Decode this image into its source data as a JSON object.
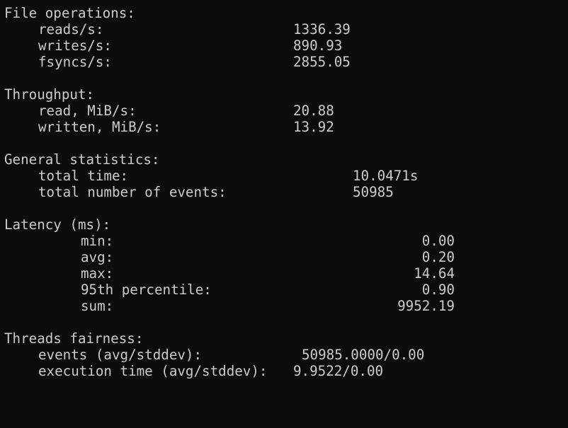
{
  "file_operations": {
    "title": "File operations:",
    "rows": [
      {
        "label": "reads/s:",
        "value": "1336.39"
      },
      {
        "label": "writes/s:",
        "value": "890.93"
      },
      {
        "label": "fsyncs/s:",
        "value": "2855.05"
      }
    ]
  },
  "throughput": {
    "title": "Throughput:",
    "rows": [
      {
        "label": "read, MiB/s:",
        "value": "20.88"
      },
      {
        "label": "written, MiB/s:",
        "value": "13.92"
      }
    ]
  },
  "general_statistics": {
    "title": "General statistics:",
    "rows": [
      {
        "label": "total time:",
        "value": "10.0471s"
      },
      {
        "label": "total number of events:",
        "value": "50985"
      }
    ]
  },
  "latency": {
    "title": "Latency (ms):",
    "rows": [
      {
        "label": "min:",
        "value": "0.00"
      },
      {
        "label": "avg:",
        "value": "0.20"
      },
      {
        "label": "max:",
        "value": "14.64"
      },
      {
        "label": "95th percentile:",
        "value": "0.90"
      },
      {
        "label": "sum:",
        "value": "9952.19"
      }
    ]
  },
  "threads_fairness": {
    "title": "Threads fairness:",
    "rows": [
      {
        "label": "events (avg/stddev):",
        "value": "50985.0000/0.00"
      },
      {
        "label": "execution time (avg/stddev):",
        "value": "9.9522/0.00"
      }
    ]
  },
  "colors": {
    "background": "#0c0c0c",
    "text": "#cccccc"
  }
}
